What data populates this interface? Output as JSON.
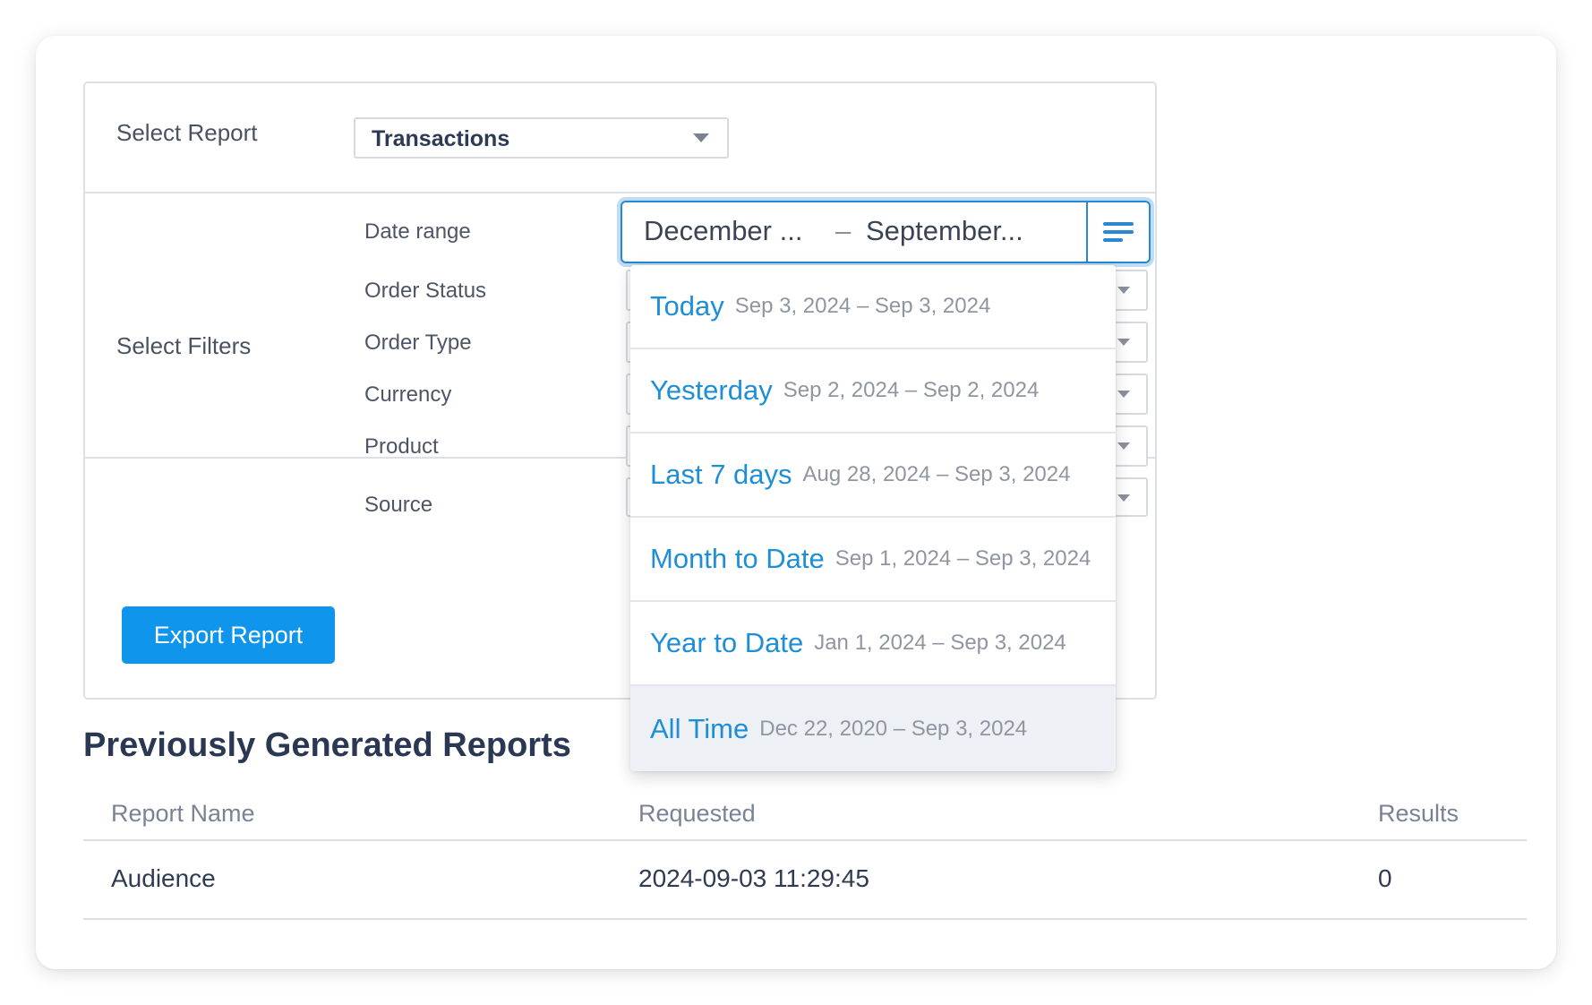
{
  "report": {
    "label": "Select Report",
    "selected": "Transactions"
  },
  "filters": {
    "label": "Select Filters",
    "date_range": {
      "label": "Date range",
      "from": "December ...",
      "separator": "–",
      "to": "September..."
    },
    "fields": [
      "Order Status",
      "Order Type",
      "Currency",
      "Product",
      "Source"
    ]
  },
  "dropdown": {
    "options": [
      {
        "name": "Today",
        "range": "Sep 3, 2024 – Sep 3, 2024"
      },
      {
        "name": "Yesterday",
        "range": "Sep 2, 2024 – Sep 2, 2024"
      },
      {
        "name": "Last 7 days",
        "range": "Aug 28, 2024 – Sep 3, 2024"
      },
      {
        "name": "Month to Date",
        "range": "Sep 1, 2024 – Sep 3, 2024"
      },
      {
        "name": "Year to Date",
        "range": "Jan 1, 2024 – Sep 3, 2024"
      },
      {
        "name": "All Time",
        "range": "Dec 22, 2020 – Sep 3, 2024"
      }
    ],
    "highlighted": "All Time"
  },
  "actions": {
    "export_label": "Export Report"
  },
  "previous": {
    "title": "Previously Generated Reports",
    "columns": [
      "Report Name",
      "Requested",
      "Results"
    ],
    "rows": [
      {
        "name": "Audience",
        "requested": "2024-09-03 11:29:45",
        "results": "0"
      }
    ]
  },
  "colors": {
    "accent": "#0f95ec",
    "link": "#1e8fd6",
    "focus_border": "#2a88d0"
  }
}
